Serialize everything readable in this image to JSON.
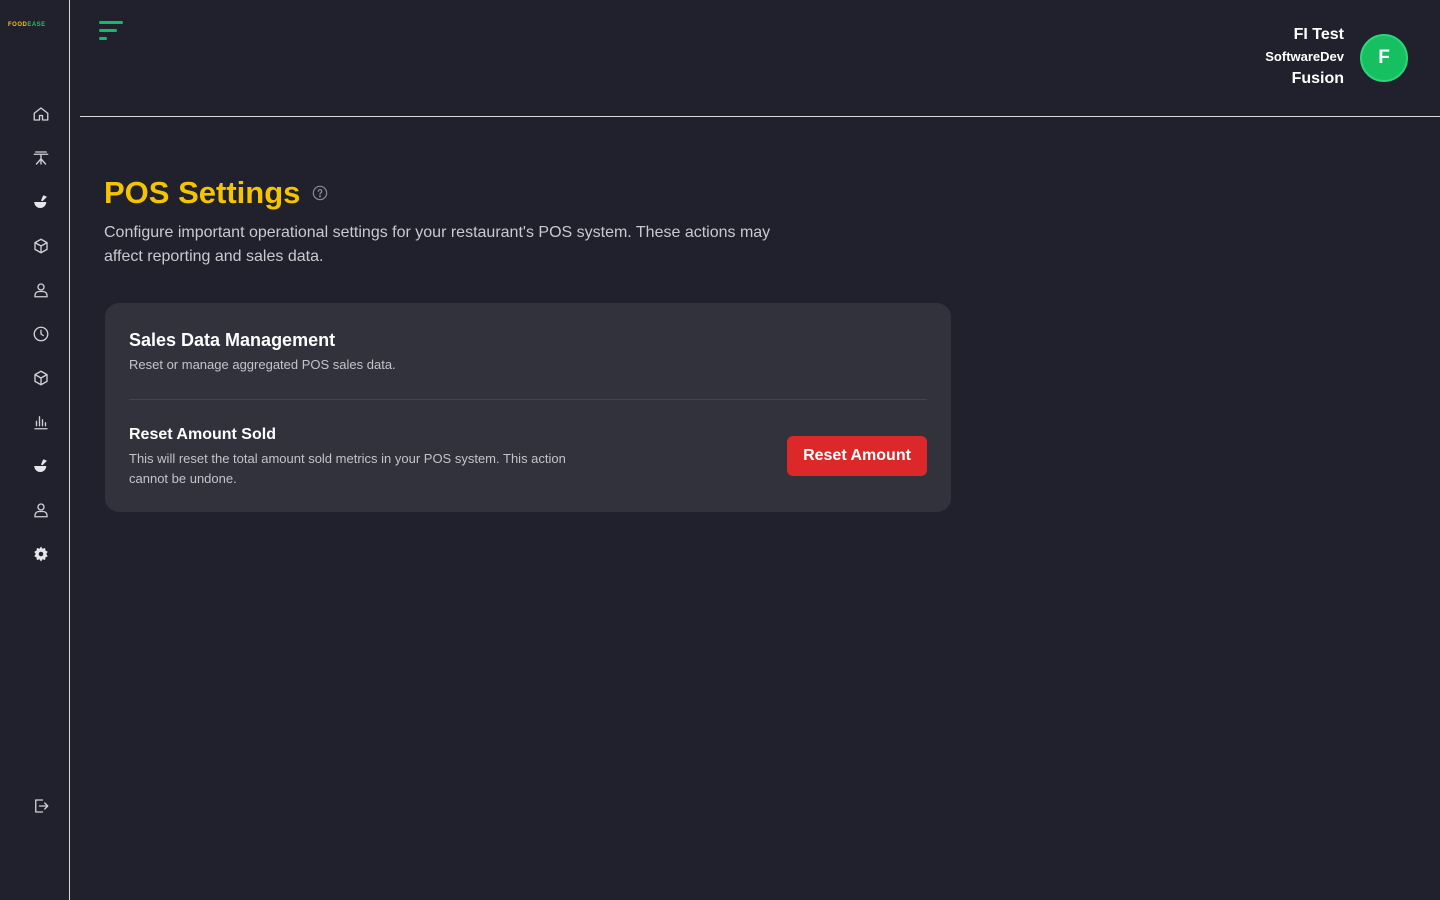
{
  "brand": {
    "logo_part1": "FOOD",
    "logo_part2": "EASE"
  },
  "sidebar": {
    "items": [
      {
        "icon": "home-icon"
      },
      {
        "icon": "table-icon"
      },
      {
        "icon": "food-icon"
      },
      {
        "icon": "package-icon"
      },
      {
        "icon": "user-icon"
      },
      {
        "icon": "clock-icon"
      },
      {
        "icon": "package-icon"
      },
      {
        "icon": "chart-icon"
      },
      {
        "icon": "food-icon"
      },
      {
        "icon": "user-icon"
      },
      {
        "icon": "settings-icon"
      }
    ],
    "logout_icon": "logout-icon"
  },
  "header": {
    "user": {
      "line1": "FI Test",
      "line2": "SoftwareDev",
      "line3": "Fusion",
      "avatar_initial": "F"
    }
  },
  "main": {
    "title": "POS Settings",
    "subtitle": "Configure important operational settings for your restaurant's POS system. These actions may affect reporting and sales data.",
    "card": {
      "title": "Sales Data Management",
      "description": "Reset or manage aggregated POS sales data.",
      "setting": {
        "title": "Reset Amount Sold",
        "description": "This will reset the total amount sold metrics in your POS system. This action cannot be undone.",
        "button_label": "Reset Amount"
      }
    }
  },
  "colors": {
    "accent_yellow": "#f5c400",
    "accent_green": "#16b96a",
    "danger": "#dc2828",
    "background": "#21212d",
    "card": "#32323c"
  }
}
